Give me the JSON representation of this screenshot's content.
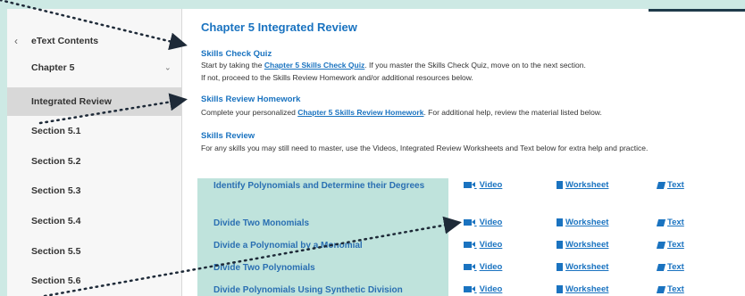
{
  "sidebar": {
    "header": "eText Contents",
    "items": [
      {
        "label": "Chapter 5",
        "chevron": "chevron-down-icon"
      },
      {
        "label": "Integrated Review",
        "active": true
      },
      {
        "label": "Section 5.1"
      },
      {
        "label": "Section 5.2"
      },
      {
        "label": "Section 5.3"
      },
      {
        "label": "Section 5.4"
      },
      {
        "label": "Section 5.5"
      },
      {
        "label": "Section 5.6"
      }
    ]
  },
  "main": {
    "title": "Chapter 5 Integrated Review",
    "quiz": {
      "heading": "Skills Check Quiz",
      "line1_pre": "Start by taking the ",
      "line1_link": "Chapter 5 Skills Check Quiz",
      "line1_post": ". If you master the Skills Check Quiz, move on to the next section.",
      "line2": "If not, proceed to the Skills Review Homework and/or additional resources below."
    },
    "homework": {
      "heading": "Skills Review Homework",
      "line_pre": "Complete your personalized ",
      "line_link": "Chapter 5 Skills Review Homework",
      "line_post": ". For additional help, review the material listed below."
    },
    "review": {
      "heading": "Skills Review",
      "line": "For any skills you may still need to master, use the Videos, Integrated Review Worksheets and Text below for extra help and practice."
    },
    "resources": {
      "video": "Video",
      "worksheet": "Worksheet",
      "text": "Text"
    },
    "topics": [
      "Identify Polynomials and Determine their Degrees",
      "Divide Two Monomials",
      "Divide a Polynomial by a Monomial",
      "Divide Two Polynomials",
      "Divide Polynomials Using Synthetic Division"
    ]
  }
}
